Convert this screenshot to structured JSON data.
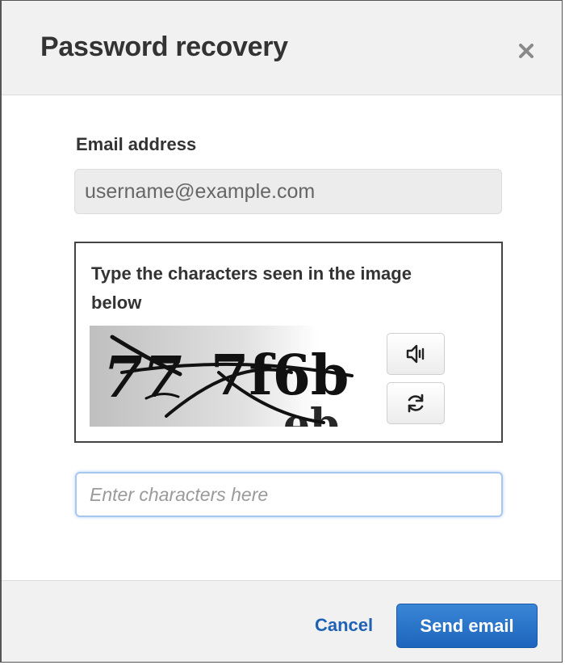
{
  "dialog": {
    "title": "Password recovery",
    "close_icon": "close-icon"
  },
  "form": {
    "email_label": "Email address",
    "email_value": "username@example.com",
    "captcha": {
      "prompt": "Type the characters seen in the image below",
      "image_text": "777f6b",
      "audio_icon": "speaker-icon",
      "refresh_icon": "refresh-icon"
    },
    "captcha_input": {
      "value": "",
      "placeholder": "Enter characters here"
    }
  },
  "footer": {
    "cancel_label": "Cancel",
    "send_label": "Send email"
  },
  "colors": {
    "header_bg": "#f1f1f1",
    "link": "#1f62b5",
    "primary_button": "#1d65bd",
    "focus_border": "#a6c8f0"
  }
}
